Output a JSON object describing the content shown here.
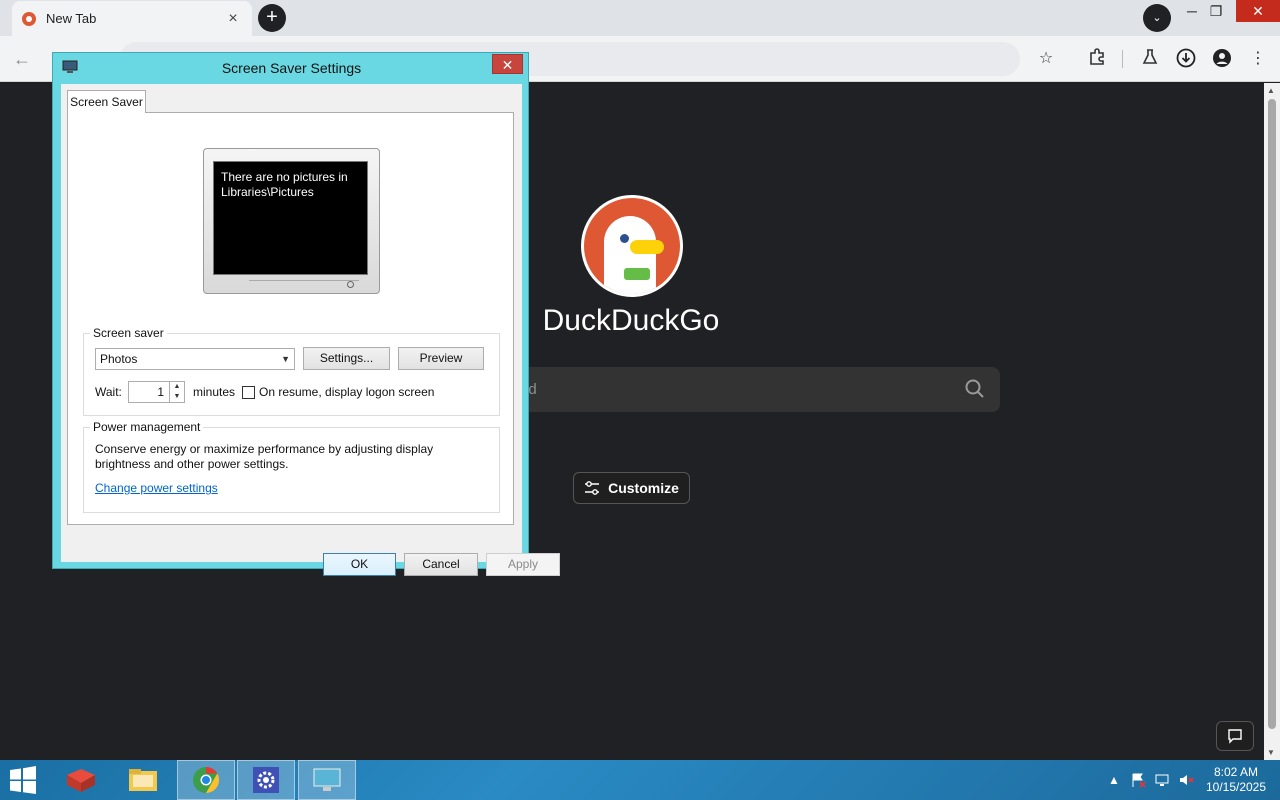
{
  "browser": {
    "tab_title": "New Tab",
    "tab_close": "×",
    "new_tab": "+",
    "tab_search": "⌄",
    "window_minimize": "─",
    "window_restore": "❐",
    "window_close": "✕"
  },
  "page": {
    "brand": "DuckDuckGo",
    "search_placeholder": "ed",
    "customize_label": "Customize"
  },
  "dialog": {
    "title": "Screen Saver Settings",
    "close": "✕",
    "tab_label": "Screen Saver",
    "preview_text": "There are no pictures in Libraries\\Pictures",
    "screen_saver_group": "Screen saver",
    "screen_saver_selected": "Photos",
    "settings_button": "Settings...",
    "preview_button": "Preview",
    "wait_label": "Wait:",
    "wait_value": "1",
    "minutes_label": "minutes",
    "resume_checkbox_label": "On resume, display logon screen",
    "resume_checked": false,
    "power_group": "Power management",
    "power_description": "Conserve energy or maximize performance by adjusting display brightness and other power settings.",
    "power_link": "Change power settings",
    "ok_button": "OK",
    "cancel_button": "Cancel",
    "apply_button": "Apply"
  },
  "taskbar": {
    "clock_time": "8:02 AM",
    "clock_date": "10/15/2025",
    "tray_expand": "▲"
  },
  "colors": {
    "dialog_frame": "#6ad8e2",
    "close_red": "#c7453d",
    "ddg_orange": "#de5833",
    "page_bg": "#202124",
    "taskbar": "#1a6fa3",
    "link": "#0066cc"
  }
}
